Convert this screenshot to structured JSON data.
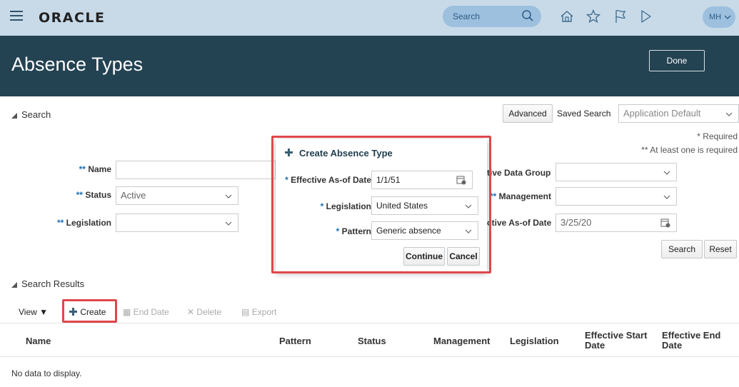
{
  "topbar": {
    "logo": "ORACLE",
    "search_label": "Search",
    "avatar_initials": "MH"
  },
  "header": {
    "title": "Absence Types",
    "done_label": "Done"
  },
  "search": {
    "section_title": "Search",
    "advanced_label": "Advanced",
    "saved_search_label": "Saved Search",
    "saved_search_value": "Application Default",
    "required_note": "* Required",
    "at_least_one_note": "** At least one is required",
    "fields": {
      "name_label": "Name",
      "name_value": "",
      "status_label": "Status",
      "status_value": "Active",
      "legislation_label": "Legislation",
      "legislation_value": "",
      "data_group_label": "tive Data Group",
      "data_group_value": "",
      "management_label": "Management",
      "management_value": "",
      "effective_label": "ctive As-of Date",
      "effective_value": "3/25/20"
    },
    "search_button": "Search",
    "reset_button": "Reset",
    "required_marker": "**"
  },
  "results": {
    "section_title": "Search Results",
    "view_label": "View",
    "create_label": "Create",
    "end_date_label": "End Date",
    "delete_label": "Delete",
    "export_label": "Export",
    "columns": [
      "Name",
      "Pattern",
      "Status",
      "Management",
      "Legislation",
      "Effective Start Date",
      "Effective End Date"
    ],
    "no_data": "No data to display."
  },
  "modal": {
    "title": "Create Absence Type",
    "effective_label": "Effective As-of Date",
    "effective_value": "1/1/51",
    "legislation_label": "Legislation",
    "legislation_value": "United States",
    "pattern_label": "Pattern",
    "pattern_value": "Generic absence",
    "continue_label": "Continue",
    "cancel_label": "Cancel",
    "required_marker": "*"
  },
  "colors": {
    "topbar": "#c8dae8",
    "header": "#234252",
    "accent": "#1a6db3",
    "highlight": "#e0474c"
  }
}
